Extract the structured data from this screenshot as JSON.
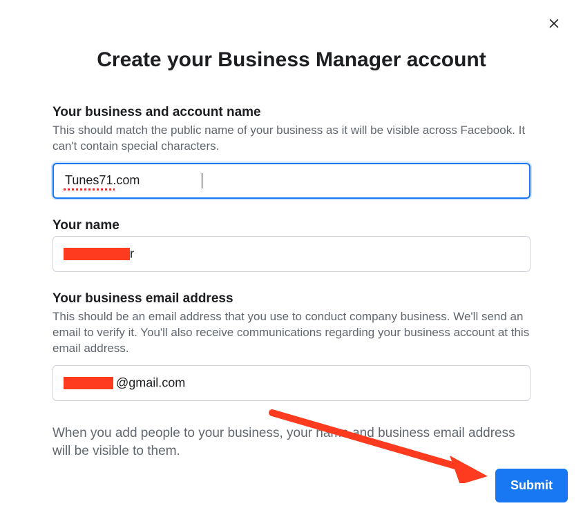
{
  "title": "Create your Business Manager account",
  "close_icon_name": "close",
  "fields": {
    "business_name": {
      "label": "Your business and account name",
      "description": "This should match the public name of your business as it will be visible across Facebook. It can't contain special characters.",
      "value": "Tunes71.com"
    },
    "your_name": {
      "label": "Your name",
      "value_suffix": "r"
    },
    "business_email": {
      "label": "Your business email address",
      "description": "This should be an email address that you use to conduct company business. We'll send an email to verify it. You'll also receive communications regarding your business account at this email address.",
      "value_suffix": "@gmail.com"
    }
  },
  "visibility_note": "When you add people to your business, your name and business email address will be visible to them.",
  "submit_label": "Submit",
  "annotation": {
    "arrow_color": "#ff3b1f"
  }
}
